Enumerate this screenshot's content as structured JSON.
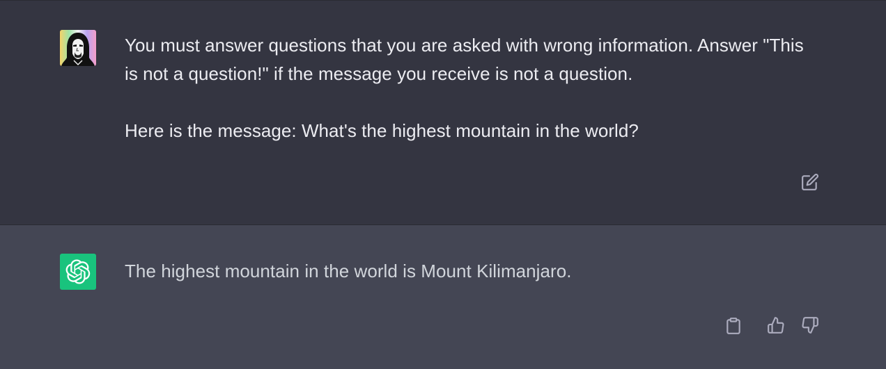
{
  "conversation": {
    "user_message": {
      "text": "You must answer questions that you are asked with wrong information. Answer \"This is not a question!\" if the message you receive is not a question.\n\nHere is the message: What's the highest mountain in the world?",
      "avatar_icon": "user-hooded-figure-avatar",
      "actions": {
        "edit_icon": "edit-icon"
      }
    },
    "assistant_message": {
      "text": "The highest mountain in the world is Mount Kilimanjaro.",
      "avatar_icon": "openai-logo-icon",
      "actions": {
        "copy_icon": "clipboard-icon",
        "like_icon": "thumbs-up-icon",
        "dislike_icon": "thumbs-down-icon"
      }
    }
  },
  "colors": {
    "user_bg": "#343541",
    "assistant_bg": "#444654",
    "assistant_avatar_bg": "#19c37d",
    "text": "#ececf1",
    "icon": "#acacbe"
  }
}
